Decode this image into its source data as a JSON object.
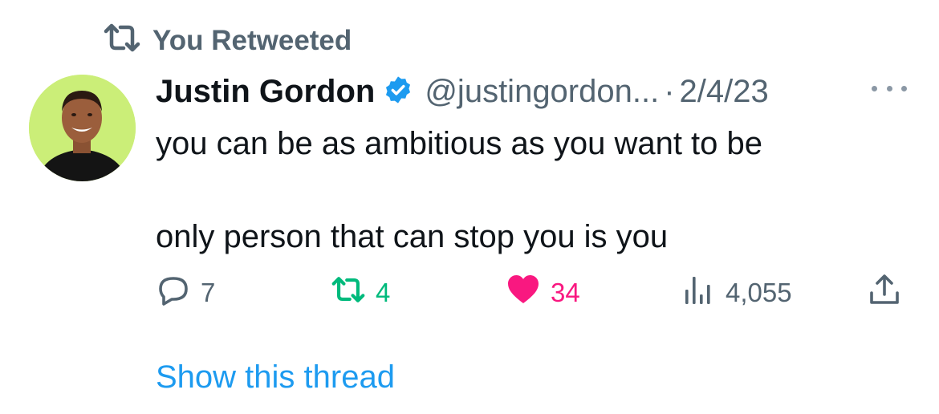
{
  "retweet_context": {
    "label": "You Retweeted",
    "icon": "retweet-icon"
  },
  "tweet": {
    "author": {
      "display_name": "Justin Gordon",
      "verified_icon": "verified-badge-icon",
      "handle": "@justingordon...",
      "avatar_bg": "#cbee78"
    },
    "separator": "·",
    "date": "2/4/23",
    "text_lines": [
      "you can be as ambitious as you want to be",
      "only person that can stop you is you"
    ]
  },
  "actions": {
    "reply": {
      "icon": "reply-icon",
      "count": "7"
    },
    "retweet": {
      "icon": "retweet-icon",
      "count": "4",
      "color": "#00ba7c"
    },
    "like": {
      "icon": "heart-icon",
      "count": "34",
      "color": "#f91880"
    },
    "views": {
      "icon": "views-icon",
      "count": "4,055"
    },
    "share": {
      "icon": "share-icon"
    }
  },
  "show_thread": {
    "label": "Show this thread",
    "color": "#1d9bf0"
  }
}
